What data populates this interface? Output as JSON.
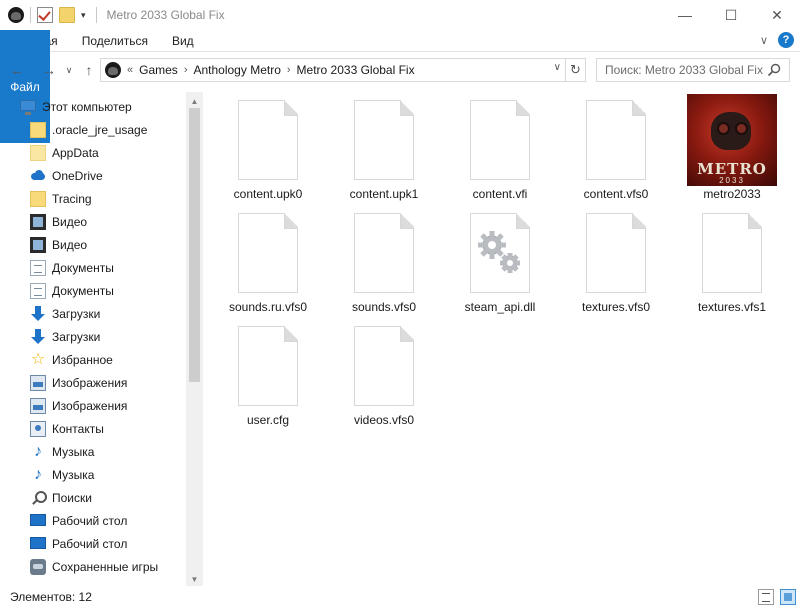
{
  "window": {
    "title": "Metro 2033 Global Fix",
    "minimize": "—",
    "maximize": "☐",
    "close": "✕"
  },
  "ribbon": {
    "tabs": [
      "Файл",
      "Главная",
      "Поделиться",
      "Вид"
    ],
    "collapse_glyph": "∨",
    "help_glyph": "?"
  },
  "address": {
    "back": "←",
    "forward": "→",
    "recent": "∨",
    "up": "↑",
    "overflow": "«",
    "crumbs": [
      "Games",
      "Anthology Metro",
      "Metro 2033 Global Fix"
    ],
    "separator": "›",
    "dropdown": "∨",
    "refresh": "↻",
    "search_placeholder": "Поиск: Metro 2033 Global Fix"
  },
  "sidebar": {
    "items": [
      {
        "label": "Этот компьютер",
        "icon": "computer-icon"
      },
      {
        "label": ".oracle_jre_usage",
        "icon": "folder-icon"
      },
      {
        "label": "AppData",
        "icon": "folder-icon"
      },
      {
        "label": "OneDrive",
        "icon": "onedrive-icon"
      },
      {
        "label": "Tracing",
        "icon": "folder-icon"
      },
      {
        "label": "Видео",
        "icon": "video-icon"
      },
      {
        "label": "Видео",
        "icon": "video-icon"
      },
      {
        "label": "Документы",
        "icon": "documents-icon"
      },
      {
        "label": "Документы",
        "icon": "documents-icon"
      },
      {
        "label": "Загрузки",
        "icon": "downloads-icon"
      },
      {
        "label": "Загрузки",
        "icon": "downloads-icon"
      },
      {
        "label": "Избранное",
        "icon": "star-icon"
      },
      {
        "label": "Изображения",
        "icon": "pictures-icon"
      },
      {
        "label": "Изображения",
        "icon": "pictures-icon"
      },
      {
        "label": "Контакты",
        "icon": "contacts-icon"
      },
      {
        "label": "Музыка",
        "icon": "music-icon"
      },
      {
        "label": "Музыка",
        "icon": "music-icon"
      },
      {
        "label": "Поиски",
        "icon": "search-icon"
      },
      {
        "label": "Рабочий стол",
        "icon": "desktop-icon"
      },
      {
        "label": "Рабочий стол",
        "icon": "desktop-icon"
      },
      {
        "label": "Сохраненные игры",
        "icon": "saved-games-icon"
      }
    ],
    "scroll_up": "▲",
    "scroll_down": "▼"
  },
  "files": [
    {
      "name": "content.upk0",
      "type": "blank-document"
    },
    {
      "name": "content.upk1",
      "type": "blank-document"
    },
    {
      "name": "content.vfi",
      "type": "blank-document"
    },
    {
      "name": "content.vfs0",
      "type": "blank-document"
    },
    {
      "name": "metro2033",
      "type": "application",
      "poster_title": "METRO",
      "poster_subtitle": "2033"
    },
    {
      "name": "sounds.ru.vfs0",
      "type": "blank-document"
    },
    {
      "name": "sounds.vfs0",
      "type": "blank-document"
    },
    {
      "name": "steam_api.dll",
      "type": "dll"
    },
    {
      "name": "textures.vfs0",
      "type": "blank-document"
    },
    {
      "name": "textures.vfs1",
      "type": "blank-document"
    },
    {
      "name": "user.cfg",
      "type": "blank-document"
    },
    {
      "name": "videos.vfs0",
      "type": "blank-document"
    }
  ],
  "status": {
    "item_count": "Элементов: 12"
  },
  "colors": {
    "accent": "#1979ca",
    "file_tab_text": "#ffffff"
  }
}
